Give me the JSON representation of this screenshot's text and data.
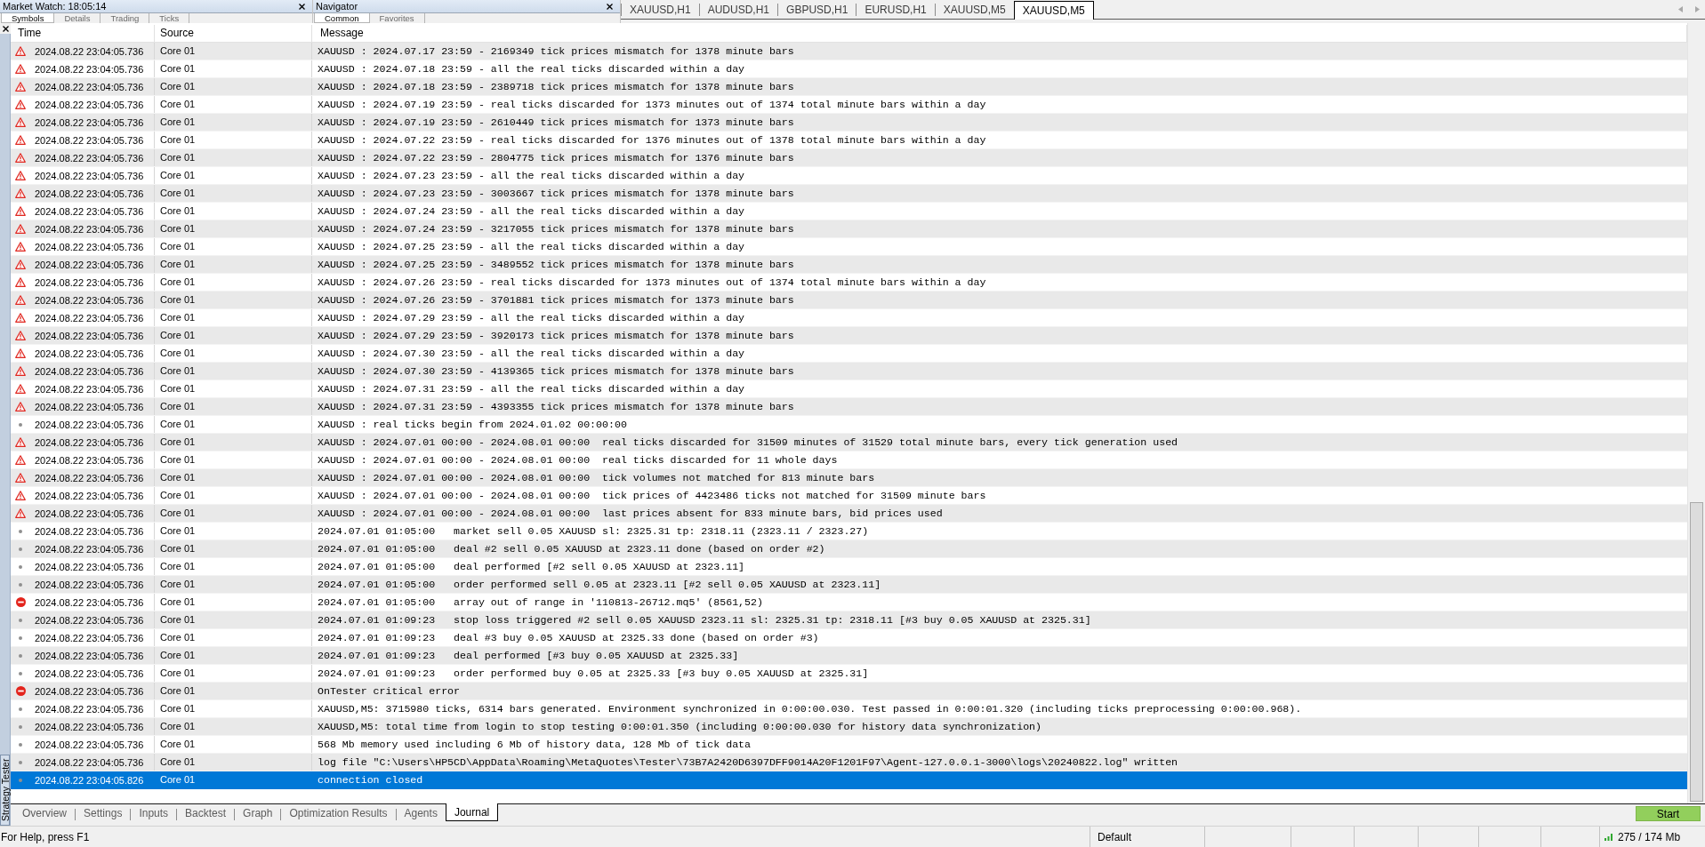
{
  "dock_panels": [
    {
      "title": "Market Watch: 18:05:14",
      "tabs": [
        {
          "label": "Symbols",
          "selected": true
        },
        {
          "label": "Details",
          "selected": false
        },
        {
          "label": "Trading",
          "selected": false
        },
        {
          "label": "Ticks",
          "selected": false
        }
      ]
    },
    {
      "title": "Navigator",
      "tabs": [
        {
          "label": "Common",
          "selected": true
        },
        {
          "label": "Favorites",
          "selected": false
        }
      ]
    }
  ],
  "chart_tabs": [
    {
      "label": "XAUUSD,H1",
      "selected": false
    },
    {
      "label": "AUDUSD,H1",
      "selected": false
    },
    {
      "label": "GBPUSD,H1",
      "selected": false
    },
    {
      "label": "EURUSD,H1",
      "selected": false
    },
    {
      "label": "XAUUSD,M5",
      "selected": false
    },
    {
      "label": "XAUUSD,M5",
      "selected": true
    }
  ],
  "tester": {
    "side_label": "Strategy Tester",
    "columns": [
      "Time",
      "Source",
      "Message"
    ],
    "rows": [
      {
        "kind": "warning",
        "time": "2024.08.22 23:04:05.736",
        "source": "Core 01",
        "message": "XAUUSD : 2024.07.17 23:59 - 2169349 tick prices mismatch for 1378 minute bars",
        "selected": false
      },
      {
        "kind": "warning",
        "time": "2024.08.22 23:04:05.736",
        "source": "Core 01",
        "message": "XAUUSD : 2024.07.18 23:59 - all the real ticks discarded within a day",
        "selected": false
      },
      {
        "kind": "warning",
        "time": "2024.08.22 23:04:05.736",
        "source": "Core 01",
        "message": "XAUUSD : 2024.07.18 23:59 - 2389718 tick prices mismatch for 1378 minute bars",
        "selected": false
      },
      {
        "kind": "warning",
        "time": "2024.08.22 23:04:05.736",
        "source": "Core 01",
        "message": "XAUUSD : 2024.07.19 23:59 - real ticks discarded for 1373 minutes out of 1374 total minute bars within a day",
        "selected": false
      },
      {
        "kind": "warning",
        "time": "2024.08.22 23:04:05.736",
        "source": "Core 01",
        "message": "XAUUSD : 2024.07.19 23:59 - 2610449 tick prices mismatch for 1373 minute bars",
        "selected": false
      },
      {
        "kind": "warning",
        "time": "2024.08.22 23:04:05.736",
        "source": "Core 01",
        "message": "XAUUSD : 2024.07.22 23:59 - real ticks discarded for 1376 minutes out of 1378 total minute bars within a day",
        "selected": false
      },
      {
        "kind": "warning",
        "time": "2024.08.22 23:04:05.736",
        "source": "Core 01",
        "message": "XAUUSD : 2024.07.22 23:59 - 2804775 tick prices mismatch for 1376 minute bars",
        "selected": false
      },
      {
        "kind": "warning",
        "time": "2024.08.22 23:04:05.736",
        "source": "Core 01",
        "message": "XAUUSD : 2024.07.23 23:59 - all the real ticks discarded within a day",
        "selected": false
      },
      {
        "kind": "warning",
        "time": "2024.08.22 23:04:05.736",
        "source": "Core 01",
        "message": "XAUUSD : 2024.07.23 23:59 - 3003667 tick prices mismatch for 1378 minute bars",
        "selected": false
      },
      {
        "kind": "warning",
        "time": "2024.08.22 23:04:05.736",
        "source": "Core 01",
        "message": "XAUUSD : 2024.07.24 23:59 - all the real ticks discarded within a day",
        "selected": false
      },
      {
        "kind": "warning",
        "time": "2024.08.22 23:04:05.736",
        "source": "Core 01",
        "message": "XAUUSD : 2024.07.24 23:59 - 3217055 tick prices mismatch for 1378 minute bars",
        "selected": false
      },
      {
        "kind": "warning",
        "time": "2024.08.22 23:04:05.736",
        "source": "Core 01",
        "message": "XAUUSD : 2024.07.25 23:59 - all the real ticks discarded within a day",
        "selected": false
      },
      {
        "kind": "warning",
        "time": "2024.08.22 23:04:05.736",
        "source": "Core 01",
        "message": "XAUUSD : 2024.07.25 23:59 - 3489552 tick prices mismatch for 1378 minute bars",
        "selected": false
      },
      {
        "kind": "warning",
        "time": "2024.08.22 23:04:05.736",
        "source": "Core 01",
        "message": "XAUUSD : 2024.07.26 23:59 - real ticks discarded for 1373 minutes out of 1374 total minute bars within a day",
        "selected": false
      },
      {
        "kind": "warning",
        "time": "2024.08.22 23:04:05.736",
        "source": "Core 01",
        "message": "XAUUSD : 2024.07.26 23:59 - 3701881 tick prices mismatch for 1373 minute bars",
        "selected": false
      },
      {
        "kind": "warning",
        "time": "2024.08.22 23:04:05.736",
        "source": "Core 01",
        "message": "XAUUSD : 2024.07.29 23:59 - all the real ticks discarded within a day",
        "selected": false
      },
      {
        "kind": "warning",
        "time": "2024.08.22 23:04:05.736",
        "source": "Core 01",
        "message": "XAUUSD : 2024.07.29 23:59 - 3920173 tick prices mismatch for 1378 minute bars",
        "selected": false
      },
      {
        "kind": "warning",
        "time": "2024.08.22 23:04:05.736",
        "source": "Core 01",
        "message": "XAUUSD : 2024.07.30 23:59 - all the real ticks discarded within a day",
        "selected": false
      },
      {
        "kind": "warning",
        "time": "2024.08.22 23:04:05.736",
        "source": "Core 01",
        "message": "XAUUSD : 2024.07.30 23:59 - 4139365 tick prices mismatch for 1378 minute bars",
        "selected": false
      },
      {
        "kind": "warning",
        "time": "2024.08.22 23:04:05.736",
        "source": "Core 01",
        "message": "XAUUSD : 2024.07.31 23:59 - all the real ticks discarded within a day",
        "selected": false
      },
      {
        "kind": "warning",
        "time": "2024.08.22 23:04:05.736",
        "source": "Core 01",
        "message": "XAUUSD : 2024.07.31 23:59 - 4393355 tick prices mismatch for 1378 minute bars",
        "selected": false
      },
      {
        "kind": "info",
        "time": "2024.08.22 23:04:05.736",
        "source": "Core 01",
        "message": "XAUUSD : real ticks begin from 2024.01.02 00:00:00",
        "selected": false
      },
      {
        "kind": "warning",
        "time": "2024.08.22 23:04:05.736",
        "source": "Core 01",
        "message": "XAUUSD : 2024.07.01 00:00 - 2024.08.01 00:00  real ticks discarded for 31509 minutes of 31529 total minute bars, every tick generation used",
        "selected": false
      },
      {
        "kind": "warning",
        "time": "2024.08.22 23:04:05.736",
        "source": "Core 01",
        "message": "XAUUSD : 2024.07.01 00:00 - 2024.08.01 00:00  real ticks discarded for 11 whole days",
        "selected": false
      },
      {
        "kind": "warning",
        "time": "2024.08.22 23:04:05.736",
        "source": "Core 01",
        "message": "XAUUSD : 2024.07.01 00:00 - 2024.08.01 00:00  tick volumes not matched for 813 minute bars",
        "selected": false
      },
      {
        "kind": "warning",
        "time": "2024.08.22 23:04:05.736",
        "source": "Core 01",
        "message": "XAUUSD : 2024.07.01 00:00 - 2024.08.01 00:00  tick prices of 4423486 ticks not matched for 31509 minute bars",
        "selected": false
      },
      {
        "kind": "warning",
        "time": "2024.08.22 23:04:05.736",
        "source": "Core 01",
        "message": "XAUUSD : 2024.07.01 00:00 - 2024.08.01 00:00  last prices absent for 833 minute bars, bid prices used",
        "selected": false
      },
      {
        "kind": "info",
        "time": "2024.08.22 23:04:05.736",
        "source": "Core 01",
        "message": "2024.07.01 01:05:00   market sell 0.05 XAUUSD sl: 2325.31 tp: 2318.11 (2323.11 / 2323.27)",
        "selected": false
      },
      {
        "kind": "info",
        "time": "2024.08.22 23:04:05.736",
        "source": "Core 01",
        "message": "2024.07.01 01:05:00   deal #2 sell 0.05 XAUUSD at 2323.11 done (based on order #2)",
        "selected": false
      },
      {
        "kind": "info",
        "time": "2024.08.22 23:04:05.736",
        "source": "Core 01",
        "message": "2024.07.01 01:05:00   deal performed [#2 sell 0.05 XAUUSD at 2323.11]",
        "selected": false
      },
      {
        "kind": "info",
        "time": "2024.08.22 23:04:05.736",
        "source": "Core 01",
        "message": "2024.07.01 01:05:00   order performed sell 0.05 at 2323.11 [#2 sell 0.05 XAUUSD at 2323.11]",
        "selected": false
      },
      {
        "kind": "error",
        "time": "2024.08.22 23:04:05.736",
        "source": "Core 01",
        "message": "2024.07.01 01:05:00   array out of range in '110813-26712.mq5' (8561,52)",
        "selected": false
      },
      {
        "kind": "info",
        "time": "2024.08.22 23:04:05.736",
        "source": "Core 01",
        "message": "2024.07.01 01:09:23   stop loss triggered #2 sell 0.05 XAUUSD 2323.11 sl: 2325.31 tp: 2318.11 [#3 buy 0.05 XAUUSD at 2325.31]",
        "selected": false
      },
      {
        "kind": "info",
        "time": "2024.08.22 23:04:05.736",
        "source": "Core 01",
        "message": "2024.07.01 01:09:23   deal #3 buy 0.05 XAUUSD at 2325.33 done (based on order #3)",
        "selected": false
      },
      {
        "kind": "info",
        "time": "2024.08.22 23:04:05.736",
        "source": "Core 01",
        "message": "2024.07.01 01:09:23   deal performed [#3 buy 0.05 XAUUSD at 2325.33]",
        "selected": false
      },
      {
        "kind": "info",
        "time": "2024.08.22 23:04:05.736",
        "source": "Core 01",
        "message": "2024.07.01 01:09:23   order performed buy 0.05 at 2325.33 [#3 buy 0.05 XAUUSD at 2325.31]",
        "selected": false
      },
      {
        "kind": "error",
        "time": "2024.08.22 23:04:05.736",
        "source": "Core 01",
        "message": "OnTester critical error",
        "selected": false
      },
      {
        "kind": "info",
        "time": "2024.08.22 23:04:05.736",
        "source": "Core 01",
        "message": "XAUUSD,M5: 3715980 ticks, 6314 bars generated. Environment synchronized in 0:00:00.030. Test passed in 0:00:01.320 (including ticks preprocessing 0:00:00.968).",
        "selected": false
      },
      {
        "kind": "info",
        "time": "2024.08.22 23:04:05.736",
        "source": "Core 01",
        "message": "XAUUSD,M5: total time from login to stop testing 0:00:01.350 (including 0:00:00.030 for history data synchronization)",
        "selected": false
      },
      {
        "kind": "info",
        "time": "2024.08.22 23:04:05.736",
        "source": "Core 01",
        "message": "568 Mb memory used including 6 Mb of history data, 128 Mb of tick data",
        "selected": false
      },
      {
        "kind": "info",
        "time": "2024.08.22 23:04:05.736",
        "source": "Core 01",
        "message": "log file \"C:\\Users\\HP5CD\\AppData\\Roaming\\MetaQuotes\\Tester\\73B7A2420D6397DFF9014A20F1201F97\\Agent-127.0.0.1-3000\\logs\\20240822.log\" written",
        "selected": false
      },
      {
        "kind": "info",
        "time": "2024.08.22 23:04:05.826",
        "source": "Core 01",
        "message": "connection closed",
        "selected": true
      }
    ],
    "tabs": [
      {
        "label": "Overview",
        "selected": false
      },
      {
        "label": "Settings",
        "selected": false
      },
      {
        "label": "Inputs",
        "selected": false
      },
      {
        "label": "Backtest",
        "selected": false
      },
      {
        "label": "Graph",
        "selected": false
      },
      {
        "label": "Optimization Results",
        "selected": false
      },
      {
        "label": "Agents",
        "selected": false
      },
      {
        "label": "Journal",
        "selected": true
      }
    ],
    "start_button": "Start"
  },
  "status_bar": {
    "help": "For Help, press F1",
    "profile": "Default",
    "memory": "275 / 174 Mb"
  }
}
